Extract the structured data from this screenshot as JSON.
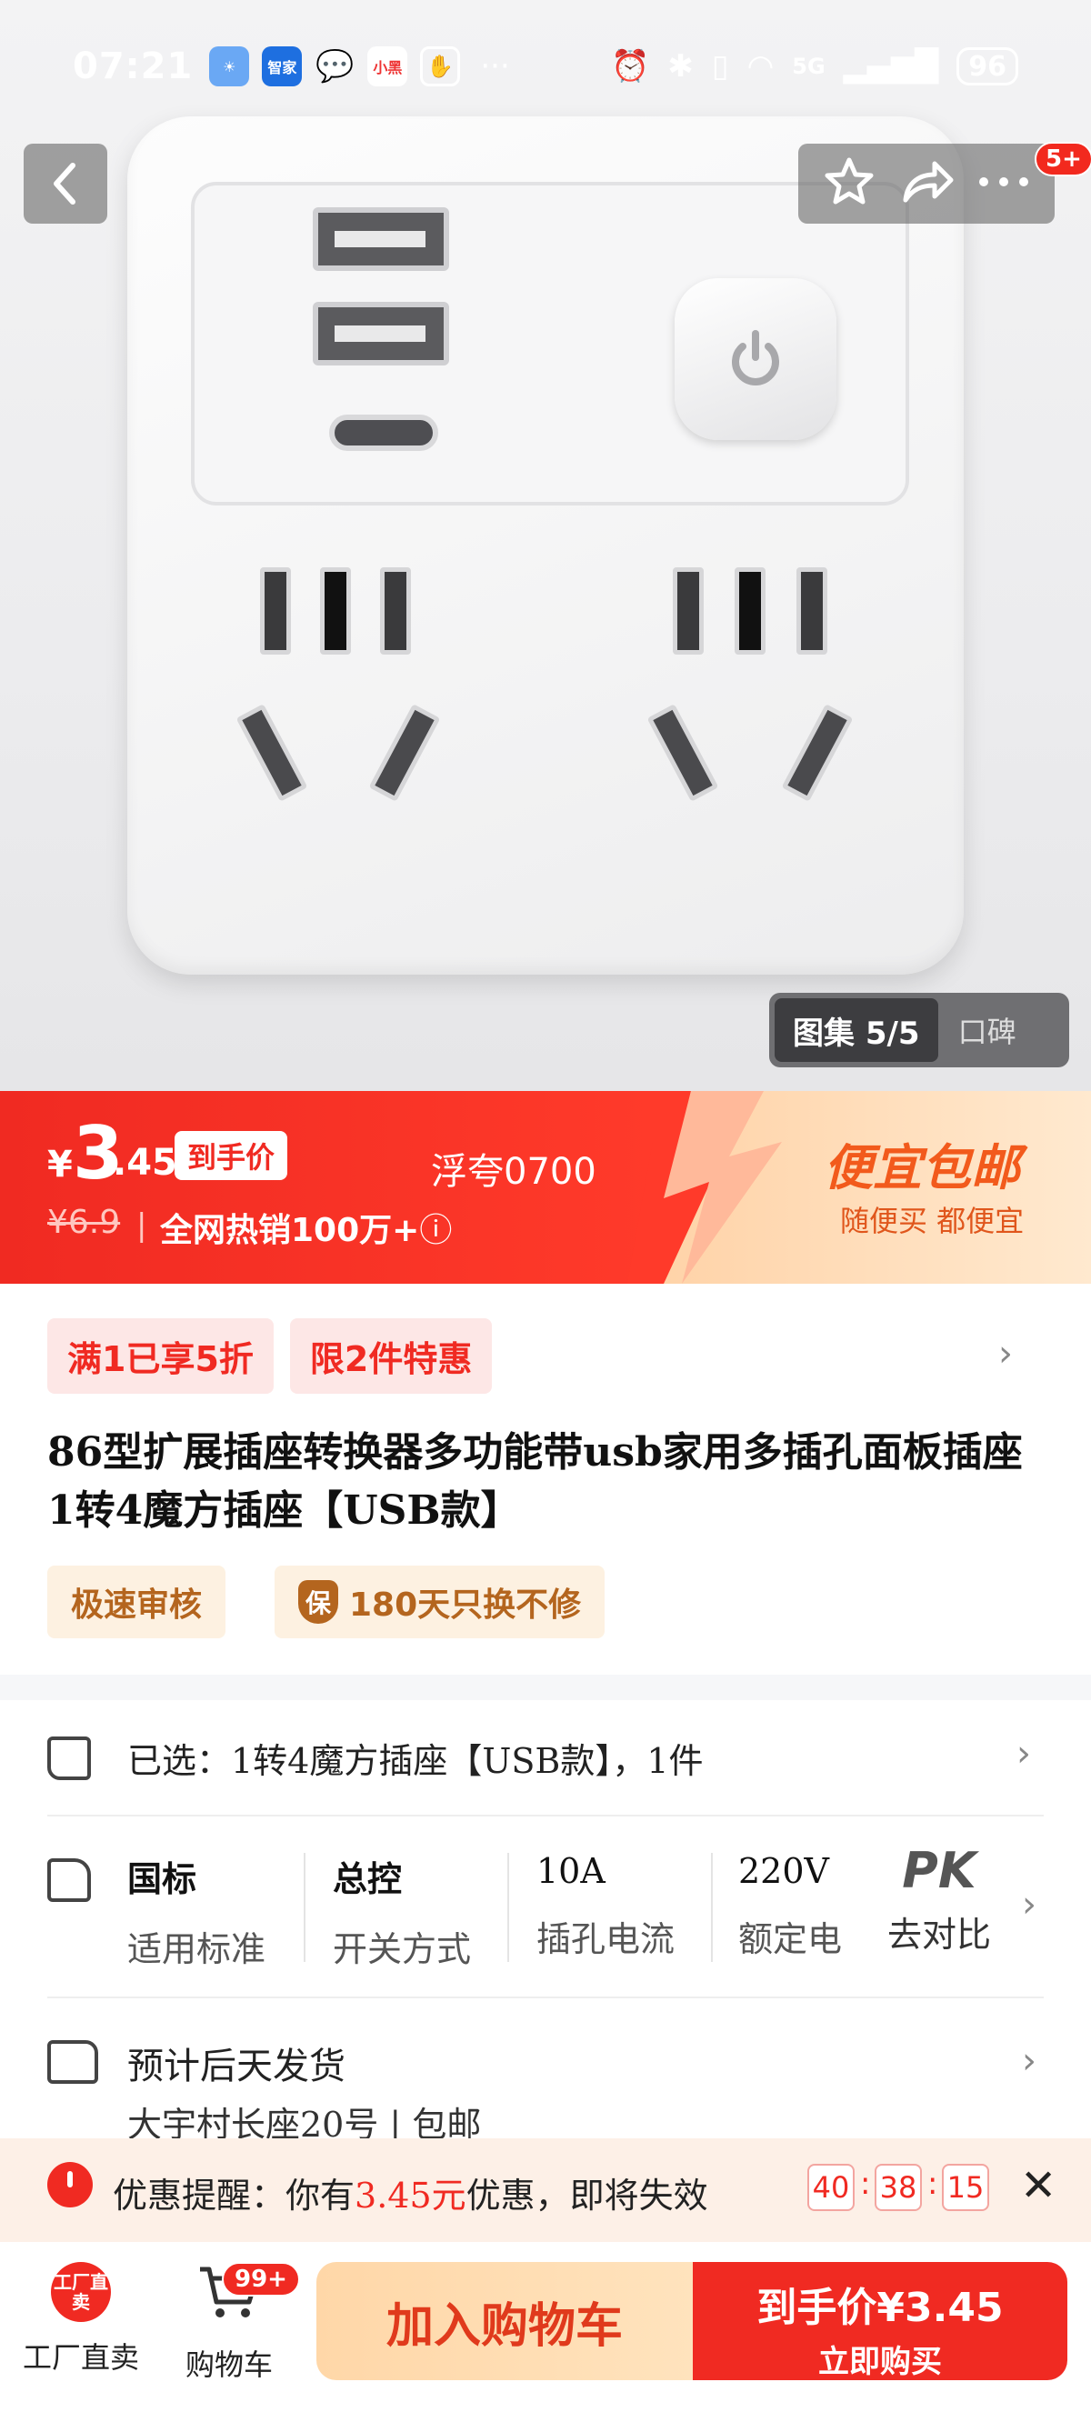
{
  "status_bar": {
    "time": "07:21",
    "app_icons": [
      "weather-icon",
      "smart-home-icon",
      "wechat-icon",
      "xiaohongshu-icon",
      "hand-icon"
    ],
    "app_labels": {
      "smart_home": "智家",
      "xiaohongshu": "小黑"
    },
    "more": "···",
    "network": "5G",
    "battery": "96"
  },
  "header": {
    "notification_badge": "5+"
  },
  "gallery": {
    "counter": "图集 5/5",
    "reviews": "口碑"
  },
  "price_banner": {
    "currency": "¥",
    "price_int": "3",
    "price_dec": ".45",
    "final_price_tag": "到手价",
    "promo_code": "浮夸0700",
    "original_price": "¥6.9",
    "separator": "|",
    "sales": "全网热销100万+",
    "info_icon": "ⓘ",
    "slogan_title": "便宜包邮",
    "slogan_sub": "随便买 都便宜"
  },
  "promo_tags": [
    "满1已享5折",
    "限2件特惠"
  ],
  "product_title": "86型扩展插座转换器多功能带usb家用多插孔面板插座 1转4魔方插座【USB款】",
  "service_tags": {
    "fast_review": "极速审核",
    "warranty_icon": "保",
    "warranty": "180天只换不修"
  },
  "selection": {
    "text": "已选：1转4魔方插座【USB款】，1件"
  },
  "specs": [
    {
      "value": "国标",
      "label": "适用标准"
    },
    {
      "value": "总控",
      "label": "开关方式"
    },
    {
      "value": "10A",
      "label": "插孔电流"
    },
    {
      "value": "220V",
      "label": "额定电"
    }
  ],
  "compare": {
    "value": "PK",
    "label": "去对比"
  },
  "shipping": {
    "eta": "预计后天发货",
    "address": "大宇村长座20号 | 包邮"
  },
  "coupon_reminder": {
    "prefix": "优惠提醒：你有",
    "amount": "3.45元",
    "suffix": "优惠，即将失效",
    "countdown": [
      "40",
      "38",
      "15"
    ],
    "separator": ":"
  },
  "bottom_bar": {
    "factory_icon_text": "工厂直卖",
    "factory_label": "工厂直卖",
    "cart_label": "购物车",
    "cart_badge": "99+",
    "add_to_cart": "加入购物车",
    "buy_now_price": "到手价¥3.45",
    "buy_now": "立即购买"
  },
  "colors": {
    "brand_red": "#f02a22",
    "promo_orange": "#f25a1c",
    "tag_brown": "#b4651e"
  }
}
